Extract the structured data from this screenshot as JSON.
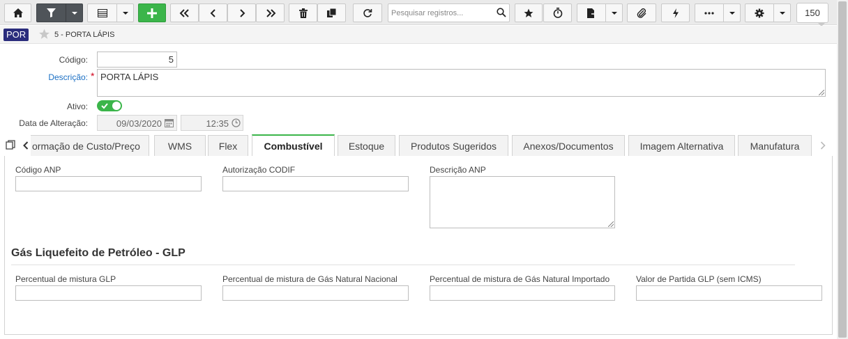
{
  "toolbar": {
    "search_placeholder": "Pesquisar registros...",
    "page_size": "150"
  },
  "record": {
    "entity_badge": "POR",
    "title": "5 - PORTA LÁPIS"
  },
  "form": {
    "codigo_label": "Código:",
    "codigo_value": "5",
    "descricao_label": "Descrição:",
    "descricao_value": "PORTA LÁPIS",
    "ativo_label": "Ativo:",
    "ativo_on": true,
    "data_alteracao_label": "Data de Alteração:",
    "data_value": "09/03/2020",
    "hora_value": "12:35"
  },
  "tabs": [
    {
      "label": "Formação de Custo/Preço",
      "shown": "ormação de Custo/Preço"
    },
    {
      "label": "WMS"
    },
    {
      "label": "Flex"
    },
    {
      "label": "Combustível",
      "active": true
    },
    {
      "label": "Estoque"
    },
    {
      "label": "Produtos Sugeridos"
    },
    {
      "label": "Anexos/Documentos"
    },
    {
      "label": "Imagem Alternativa"
    },
    {
      "label": "Manufatura"
    }
  ],
  "combustivel": {
    "codigo_anp_label": "Código ANP",
    "codigo_anp_value": "",
    "autorizacao_codif_label": "Autorização CODIF",
    "autorizacao_codif_value": "",
    "descricao_anp_label": "Descrição ANP",
    "descricao_anp_value": "",
    "glp_section_title": "Gás Liquefeito de Petróleo - GLP",
    "perc_glp_label": "Percentual de mistura GLP",
    "perc_glp_value": "",
    "perc_gn_nacional_label": "Percentual de mistura de Gás Natural Nacional",
    "perc_gn_nacional_value": "",
    "perc_gn_importado_label": "Percentual de mistura de Gás Natural Importado",
    "perc_gn_importado_value": "",
    "valor_partida_label": "Valor de Partida GLP (sem ICMS)",
    "valor_partida_value": ""
  },
  "colors": {
    "accent_green": "#3bb54a",
    "badge_navy": "#2a2c7c",
    "required_label_blue": "#1a6fc4",
    "required_star_red": "#d0021b"
  },
  "icons": [
    "home-icon",
    "filter-icon",
    "grid-view-icon",
    "plus-icon",
    "first-record-icon",
    "previous-record-icon",
    "next-record-icon",
    "last-record-icon",
    "trash-icon",
    "duplicate-icon",
    "refresh-icon",
    "search-icon",
    "star-icon",
    "stopwatch-icon",
    "document-export-icon",
    "paperclip-icon",
    "lightning-icon",
    "ellipsis-icon",
    "gear-icon",
    "calendar-icon",
    "clock-icon",
    "copy-icon",
    "chevron-left-icon",
    "chevron-right-icon"
  ]
}
